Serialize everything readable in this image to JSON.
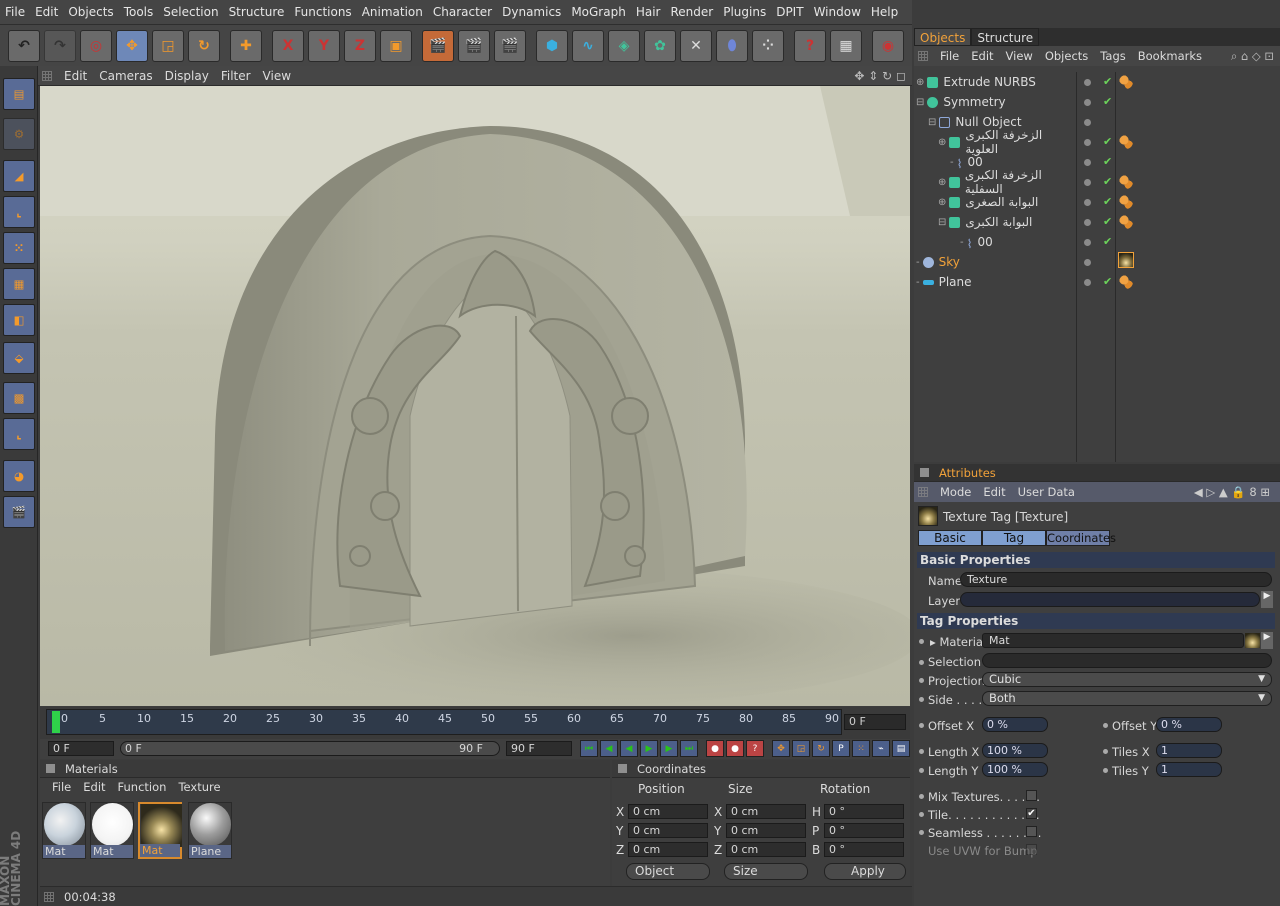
{
  "menubar": [
    "File",
    "Edit",
    "Objects",
    "Tools",
    "Selection",
    "Structure",
    "Functions",
    "Animation",
    "Character",
    "Dynamics",
    "MoGraph",
    "Hair",
    "Render",
    "Plugins",
    "DPIT",
    "Window",
    "Help"
  ],
  "toolbar": {
    "axis_x": "X",
    "axis_y": "Y",
    "axis_z": "Z"
  },
  "viewport": {
    "menu": [
      "Edit",
      "Cameras",
      "Display",
      "Filter",
      "View"
    ]
  },
  "timeline": {
    "ticks": [
      "0",
      "5",
      "10",
      "15",
      "20",
      "25",
      "30",
      "35",
      "40",
      "45",
      "50",
      "55",
      "60",
      "65",
      "70",
      "75",
      "80",
      "85",
      "90"
    ],
    "current_frame": "0 F",
    "start": "0 F",
    "range_start": "0 F",
    "range_end": "90 F",
    "end": "90 F"
  },
  "materials": {
    "title": "Materials",
    "menu": [
      "File",
      "Edit",
      "Function",
      "Texture"
    ],
    "items": [
      {
        "label": "Mat"
      },
      {
        "label": "Mat"
      },
      {
        "label": "Mat",
        "selected": true
      },
      {
        "label": "Plane"
      }
    ]
  },
  "coordinates": {
    "title": "Coordinates",
    "headers": [
      "Position",
      "Size",
      "Rotation"
    ],
    "position": [
      {
        "axis": "X",
        "value": "0 cm"
      },
      {
        "axis": "Y",
        "value": "0 cm"
      },
      {
        "axis": "Z",
        "value": "0 cm"
      }
    ],
    "size": [
      {
        "axis": "X",
        "value": "0 cm"
      },
      {
        "axis": "Y",
        "value": "0 cm"
      },
      {
        "axis": "Z",
        "value": "0 cm"
      }
    ],
    "rotation": [
      {
        "axis": "H",
        "value": "0 °"
      },
      {
        "axis": "P",
        "value": "0 °"
      },
      {
        "axis": "B",
        "value": "0 °"
      }
    ],
    "mode": "Object",
    "size_mode": "Size",
    "apply": "Apply"
  },
  "status": {
    "time": "00:04:38"
  },
  "brand": "MAXON CINEMA 4D",
  "objects": {
    "tabs": [
      "Objects",
      "Structure"
    ],
    "menu": [
      "File",
      "Edit",
      "View",
      "Objects",
      "Tags",
      "Bookmarks"
    ],
    "rows": [
      {
        "name": "Extrude NURBS",
        "tags": true,
        "check": true
      },
      {
        "name": "Symmetry",
        "tags": false,
        "check": true
      },
      {
        "name": "Null Object",
        "tags": false,
        "check": false
      },
      {
        "name": "الزخرفة الكبرى العلوية",
        "tags": true,
        "check": true
      },
      {
        "name": "00",
        "tags": false,
        "check": true
      },
      {
        "name": "الزخرفة الكبرى السفلية",
        "tags": true,
        "check": true
      },
      {
        "name": "البوابة الصغرى",
        "tags": true,
        "check": true
      },
      {
        "name": "البوابة الكبرى",
        "tags": true,
        "check": true
      },
      {
        "name": "00",
        "tags": false,
        "check": true
      },
      {
        "name": "Sky",
        "tags": false,
        "check": false
      },
      {
        "name": "Plane",
        "tags": true,
        "check": true
      }
    ]
  },
  "attributes": {
    "title": "Attributes",
    "menu": [
      "Mode",
      "Edit",
      "User Data"
    ],
    "object_title": "Texture Tag [Texture]",
    "tabs": [
      "Basic",
      "Tag",
      "Coordinates"
    ],
    "basic_header": "Basic Properties",
    "name_label": "Name",
    "name_value": "Texture",
    "layer_label": "Layer",
    "tag_header": "Tag Properties",
    "material_label": "Material",
    "material_value": "Mat",
    "selection_label": "Selection",
    "projection_label": "Projection",
    "projection_value": "Cubic",
    "side_label": "Side . . . .",
    "side_value": "Both",
    "offsetx_label": "Offset X",
    "offsetx_value": "0 %",
    "offsety_label": "Offset Y",
    "offsety_value": "0 %",
    "lengthx_label": "Length X",
    "lengthx_value": "100 %",
    "tilesx_label": "Tiles X",
    "tilesx_value": "1",
    "lengthy_label": "Length Y",
    "lengthy_value": "100 %",
    "tilesy_label": "Tiles Y",
    "tilesy_value": "1",
    "mix_label": "Mix Textures. . . . . .",
    "tile_label": "Tile. . . . . . . . . . . . .",
    "seamless_label": "Seamless . . . . . . . .",
    "uvw_label": "Use UVW for Bump"
  },
  "colors": {
    "accent": "#f2a23a",
    "panel": "#3f3f3f",
    "header": "#2f3a52"
  }
}
